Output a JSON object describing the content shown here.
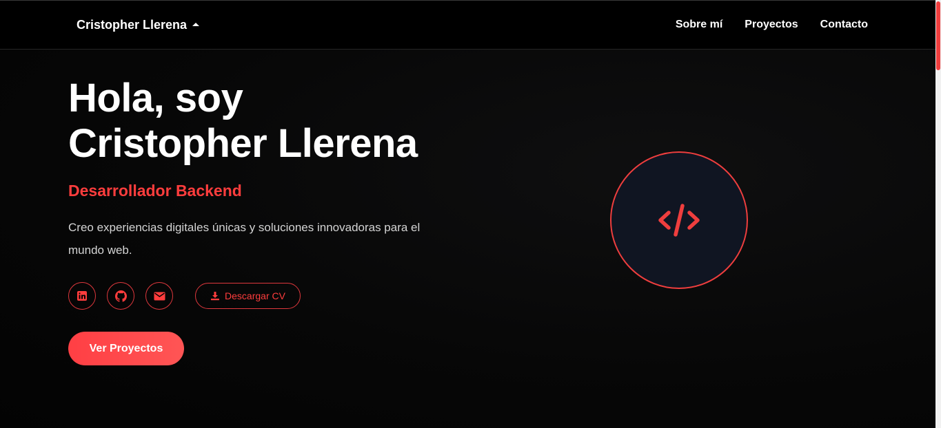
{
  "navbar": {
    "brand": "Cristopher Llerena",
    "links": [
      "Sobre mí",
      "Proyectos",
      "Contacto"
    ]
  },
  "hero": {
    "greeting": "Hola, soy",
    "name": "Cristopher Llerena",
    "role": "Desarrollador Backend",
    "description": "Creo experiencias digitales únicas y soluciones innovadoras para el mundo web.",
    "social_icons": [
      "linkedin-icon",
      "github-icon",
      "envelope-icon"
    ],
    "cv_button": "Descargar CV",
    "cta_button": "Ver Proyectos",
    "illustration_icon": "code-icon"
  },
  "colors": {
    "accent": "#ff3d3d",
    "background": "#000000",
    "circle_fill": "#101522"
  }
}
